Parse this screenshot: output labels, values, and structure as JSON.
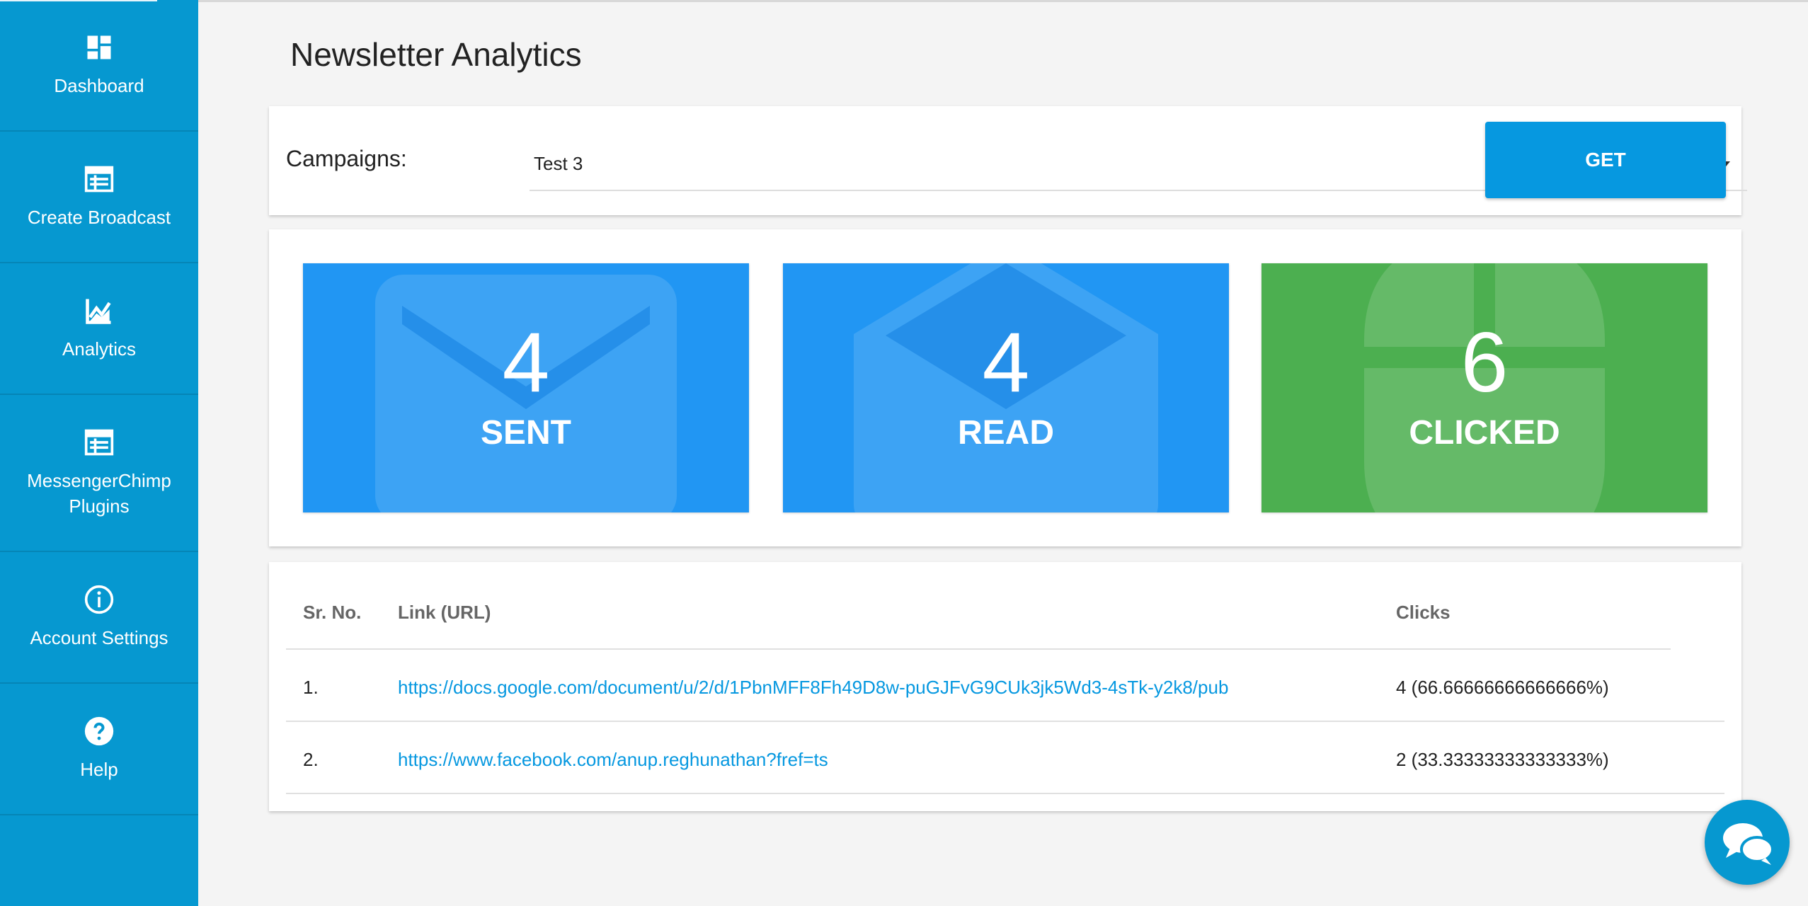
{
  "sidebar": {
    "items": [
      {
        "label": "Dashboard",
        "icon": "dashboard-icon"
      },
      {
        "label": "Create Broadcast",
        "icon": "broadcast-icon"
      },
      {
        "label": "Analytics",
        "icon": "analytics-chart-icon"
      },
      {
        "label": "MessengerChimp Plugins",
        "icon": "plugins-icon"
      },
      {
        "label": "Account Settings",
        "icon": "info-icon"
      },
      {
        "label": "Help",
        "icon": "help-icon"
      }
    ]
  },
  "page": {
    "title": "Newsletter Analytics"
  },
  "campaign": {
    "label": "Campaigns:",
    "selected": "Test 3",
    "button": "GET"
  },
  "stats": [
    {
      "value": "4",
      "label": "SENT",
      "color": "#2196f3",
      "icon": "envelope-icon"
    },
    {
      "value": "4",
      "label": "READ",
      "color": "#2196f3",
      "icon": "open-envelope-icon"
    },
    {
      "value": "6",
      "label": "CLICKED",
      "color": "#4caf50",
      "icon": "mouse-icon"
    }
  ],
  "table": {
    "headers": [
      "Sr. No.",
      "Link (URL)",
      "Clicks"
    ],
    "rows": [
      {
        "sr": "1.",
        "url": "https://docs.google.com/document/u/2/d/1PbnMFF8Fh49D8w-puGJFvG9CUk3jk5Wd3-4sTk-y2k8/pub",
        "clicks": "4 (66.66666666666666%)"
      },
      {
        "sr": "2.",
        "url": "https://www.facebook.com/anup.reghunathan?fref=ts",
        "clicks": "2 (33.33333333333333%)"
      }
    ]
  },
  "colors": {
    "sidebar": "#0698d0",
    "accent": "#0698e0",
    "tile_blue": "#2196f3",
    "tile_green": "#4caf50"
  }
}
